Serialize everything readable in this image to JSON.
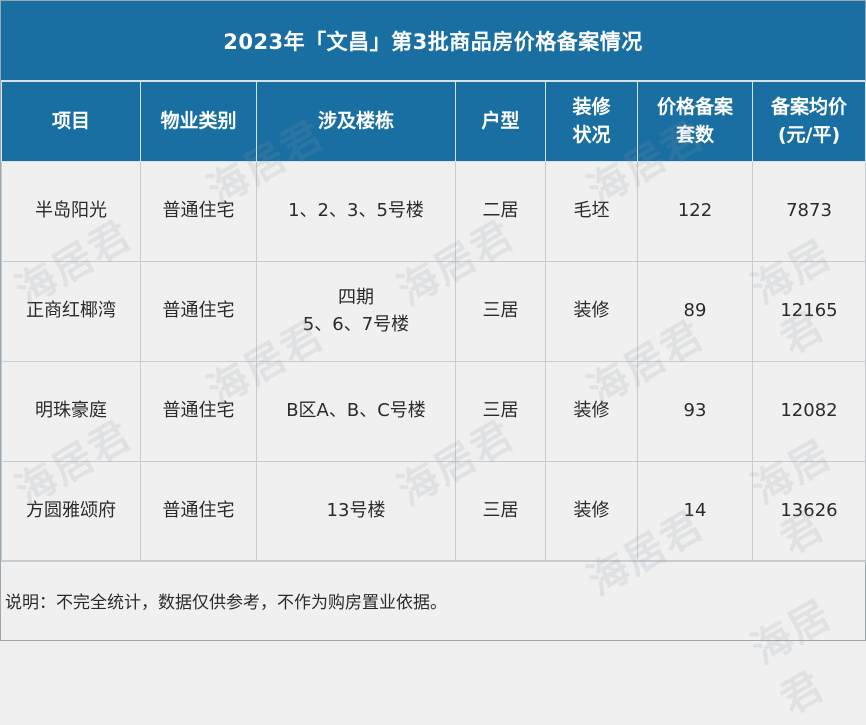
{
  "title": "2023年「文昌」第3批商品房价格备案情况",
  "columns": [
    {
      "line1": "项目",
      "line2": ""
    },
    {
      "line1": "物业类别",
      "line2": ""
    },
    {
      "line1": "涉及楼栋",
      "line2": ""
    },
    {
      "line1": "户型",
      "line2": ""
    },
    {
      "line1": "装修",
      "line2": "状况"
    },
    {
      "line1": "价格备案",
      "line2": "套数"
    },
    {
      "line1": "备案均价",
      "line2": "(元/平)"
    }
  ],
  "rows": [
    {
      "project": "半岛阳光",
      "category": "普通住宅",
      "buildings_line1": "1、2、3、5号楼",
      "buildings_line2": "",
      "layout": "二居",
      "decoration": "毛坯",
      "units": "122",
      "avg_price": "7873"
    },
    {
      "project": "正商红椰湾",
      "category": "普通住宅",
      "buildings_line1": "四期",
      "buildings_line2": "5、6、7号楼",
      "layout": "三居",
      "decoration": "装修",
      "units": "89",
      "avg_price": "12165"
    },
    {
      "project": "明珠豪庭",
      "category": "普通住宅",
      "buildings_line1": "B区A、B、C号楼",
      "buildings_line2": "",
      "layout": "三居",
      "decoration": "装修",
      "units": "93",
      "avg_price": "12082"
    },
    {
      "project": "方圆雅颂府",
      "category": "普通住宅",
      "buildings_line1": "13号楼",
      "buildings_line2": "",
      "layout": "三居",
      "decoration": "装修",
      "units": "14",
      "avg_price": "13626"
    }
  ],
  "note": "说明：不完全统计，数据仅供参考，不作为购房置业依据。",
  "watermark": "海居君",
  "colors": {
    "header_bg": "#1a6fa2",
    "body_bg": "#f0f0f0",
    "grid_line": "#c6ccd1"
  }
}
